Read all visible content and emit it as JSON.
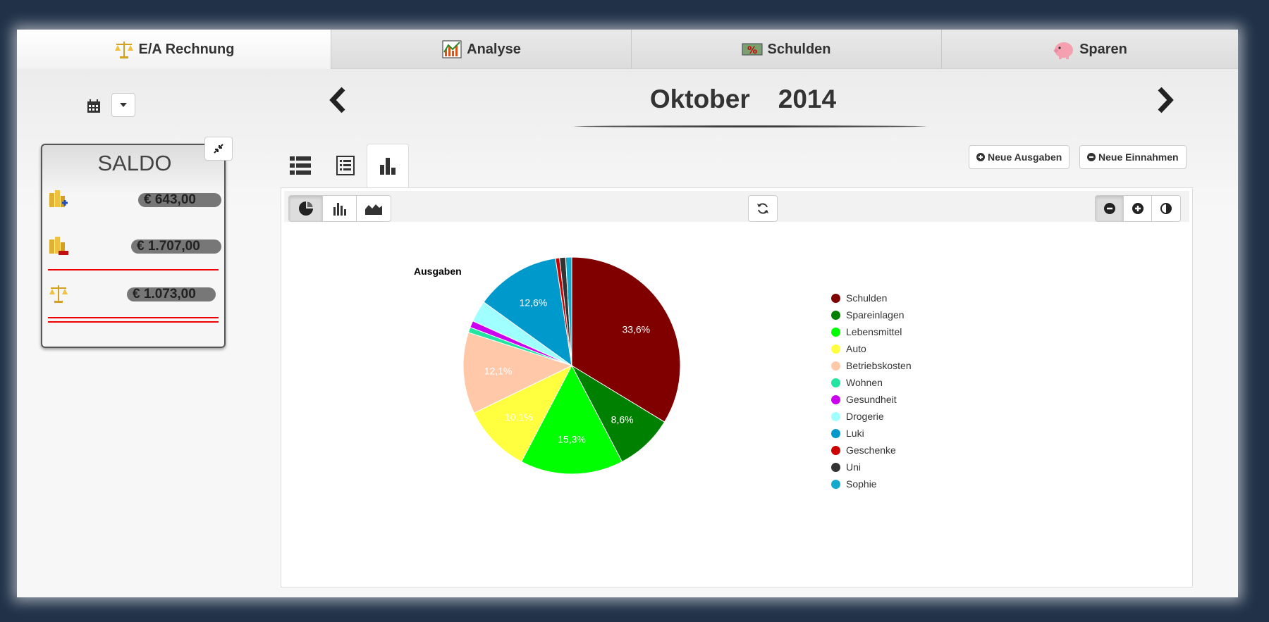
{
  "tabs": [
    {
      "label": "E/A Rechnung",
      "icon": "scales-icon",
      "active": true
    },
    {
      "label": "Analyse",
      "icon": "chart-icon",
      "active": false
    },
    {
      "label": "Schulden",
      "icon": "debt-icon",
      "active": false
    },
    {
      "label": "Sparen",
      "icon": "piggy-bank-icon",
      "active": false
    }
  ],
  "period": {
    "month": "Oktober",
    "year": "2014"
  },
  "saldo": {
    "title": "SALDO",
    "income_amount": "€ 643,00",
    "expense_amount": "€ 1.707,00",
    "balance_amount": "€ 1.073,00"
  },
  "actions": {
    "new_expense": "Neue Ausgaben",
    "new_income": "Neue Einnahmen"
  },
  "colors": {
    "bg": "#213248",
    "accent_red": "#e00000"
  },
  "chart_data": {
    "type": "pie",
    "title": "Ausgaben",
    "slices": [
      {
        "name": "Schulden",
        "value": 33.6,
        "color": "#800000",
        "label": "33,6%"
      },
      {
        "name": "Spareinlagen",
        "value": 8.6,
        "color": "#008000",
        "label": "8,6%"
      },
      {
        "name": "Lebensmittel",
        "value": 15.3,
        "color": "#00ff00",
        "label": "15,3%"
      },
      {
        "name": "Auto",
        "value": 10.1,
        "color": "#ffff40",
        "label": "10,1%"
      },
      {
        "name": "Betriebskosten",
        "value": 12.1,
        "color": "#ffc8a8",
        "label": "12,1%"
      },
      {
        "name": "Wohnen",
        "value": 0.8,
        "color": "#22e6a0",
        "label": ""
      },
      {
        "name": "Gesundheit",
        "value": 1.0,
        "color": "#cc00ee",
        "label": ""
      },
      {
        "name": "Drogerie",
        "value": 3.2,
        "color": "#a0ffff",
        "label": ""
      },
      {
        "name": "Luki",
        "value": 12.6,
        "color": "#0099cc",
        "label": "12,6%"
      },
      {
        "name": "Geschenke",
        "value": 0.6,
        "color": "#cc0000",
        "label": ""
      },
      {
        "name": "Uni",
        "value": 0.9,
        "color": "#333333",
        "label": ""
      },
      {
        "name": "Sophie",
        "value": 0.9,
        "color": "#11aacc",
        "label": ""
      }
    ]
  }
}
